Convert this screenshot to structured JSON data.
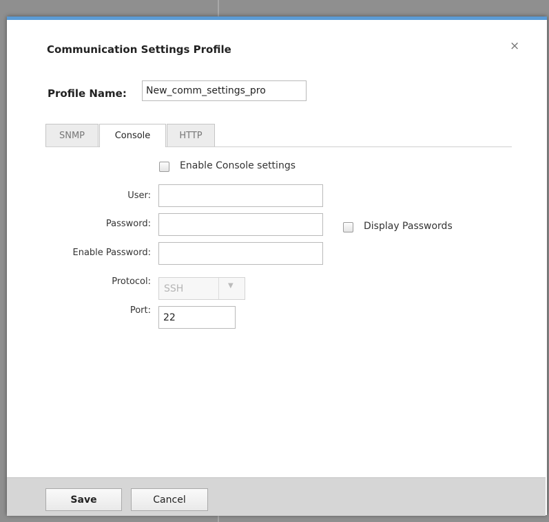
{
  "dialog": {
    "title": "Communication Settings Profile",
    "close_label": "×",
    "accent_color": "#5b9bd5"
  },
  "profile": {
    "label": "Profile Name:",
    "value": "New_comm_settings_pro"
  },
  "tabs": [
    {
      "label": "SNMP",
      "active": false
    },
    {
      "label": "Console",
      "active": true
    },
    {
      "label": "HTTP",
      "active": false
    }
  ],
  "console": {
    "enable_label": "Enable Console settings",
    "enable_checked": false,
    "user": {
      "label": "User:",
      "value": ""
    },
    "password": {
      "label": "Password:",
      "value": ""
    },
    "display_passwords_label": "Display Passwords",
    "display_passwords_checked": false,
    "enable_password": {
      "label": "Enable Password:",
      "value": ""
    },
    "protocol": {
      "label": "Protocol:",
      "value": "SSH",
      "disabled": true
    },
    "port": {
      "label": "Port:",
      "value": "22"
    }
  },
  "footer": {
    "save_label": "Save",
    "cancel_label": "Cancel"
  }
}
